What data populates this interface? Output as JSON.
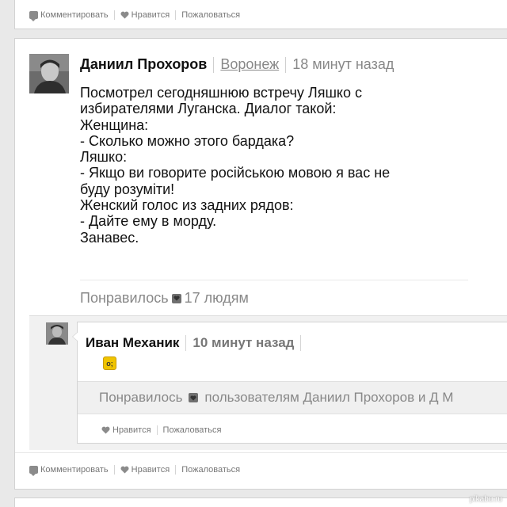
{
  "top_card": {
    "actions": [
      "Комментировать",
      "Нравится",
      "Пожаловаться"
    ]
  },
  "post": {
    "author": "Даниил Прохоров",
    "city": "Воронеж",
    "time": "18 минут назад",
    "text": "Посмотрел сегодняшнюю встречу Ляшко с\nизбирателями Луганска. Диалог такой:\nЖенщина:\n- Сколько можно этого бардака?\nЛяшко:\n- Якщо ви говорите російською мовою я вас не\nбуду розуміти!\nЖенский голос из задних рядов:\n- Дайте ему в морду.\nЗанавес.",
    "likes_prefix": "Понравилось",
    "likes_suffix": "17 людям",
    "actions": [
      "Комментировать",
      "Нравится",
      "Пожаловаться"
    ]
  },
  "reply": {
    "author": "Иван Механик",
    "time": "10 минут назад",
    "sticker": "o;",
    "likes_prefix": "Понравилось",
    "likes_suffix": "пользователям Даниил Прохоров и Д М",
    "actions": [
      "Нравится",
      "Пожаловаться"
    ]
  },
  "watermark": "pikabu.ru"
}
